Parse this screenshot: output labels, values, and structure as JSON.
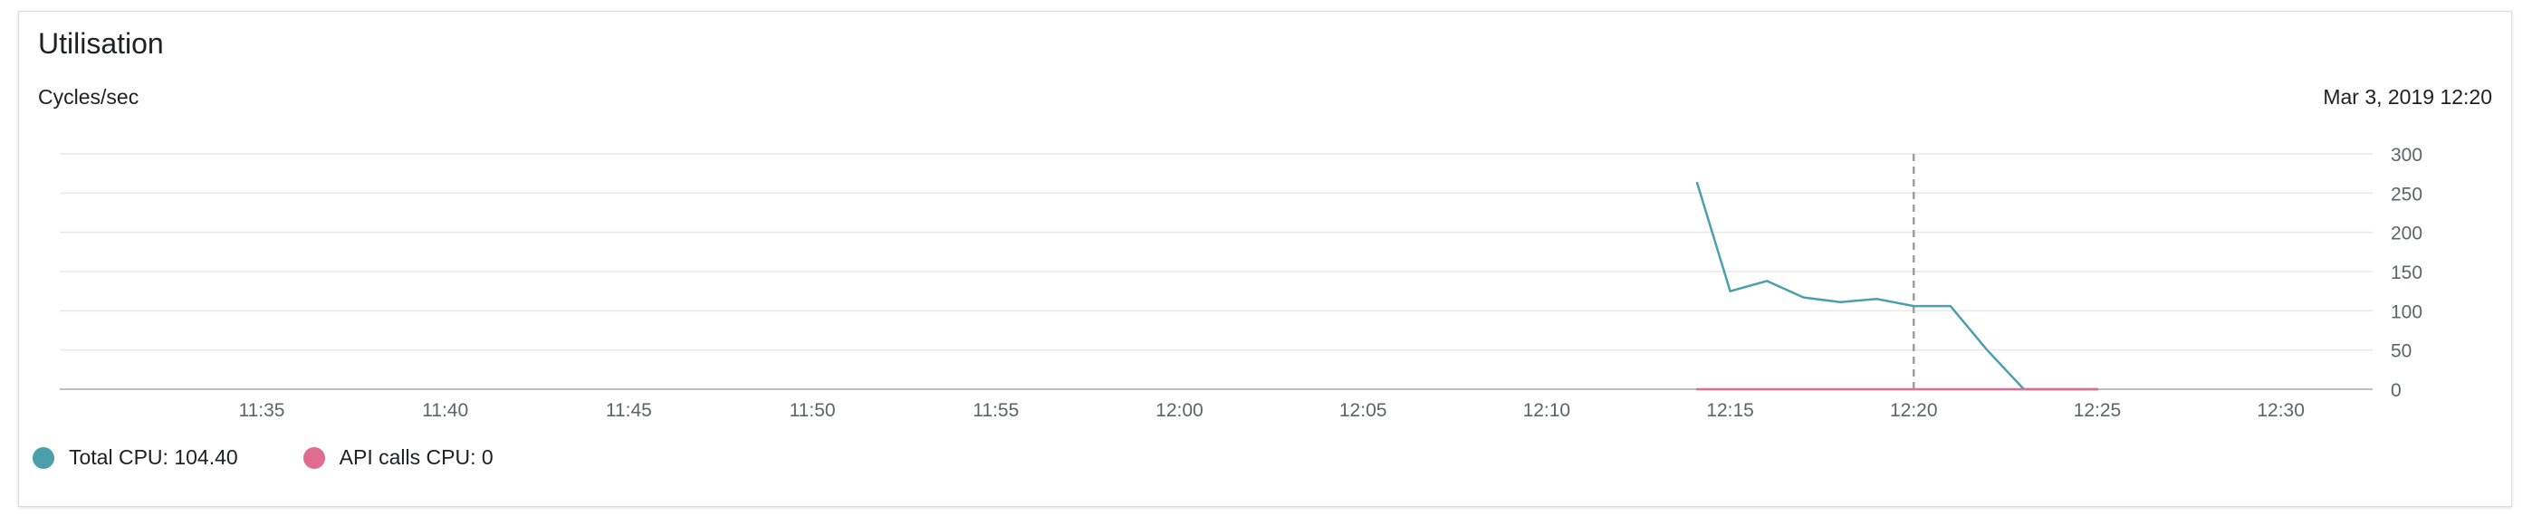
{
  "card": {
    "title": "Utilisation",
    "units": "Cycles/sec",
    "timestamp": "Mar 3, 2019 12:20"
  },
  "legend": {
    "items": [
      {
        "label": "Total CPU: 104.40",
        "color": "#4a9fab",
        "icon": "circle-dot"
      },
      {
        "label": "API calls CPU: 0",
        "color": "#e06c91",
        "icon": "circle-dot"
      }
    ]
  },
  "chart_data": {
    "type": "line",
    "x_axis_unit": "minutes",
    "x_ticks": [
      "11:35",
      "11:40",
      "11:45",
      "11:50",
      "11:55",
      "12:00",
      "12:05",
      "12:10",
      "12:15",
      "12:20",
      "12:25",
      "12:30"
    ],
    "x_tick_values": [
      695,
      700,
      705,
      710,
      715,
      720,
      725,
      730,
      735,
      740,
      745,
      750
    ],
    "xlim": [
      689.5,
      752.5
    ],
    "y_ticks": [
      0,
      50,
      100,
      150,
      200,
      250,
      300
    ],
    "ylim": [
      0,
      300
    ],
    "y_axis_position": "right",
    "grid": true,
    "cursor_x": 740,
    "series": [
      {
        "name": "Total CPU",
        "color": "#4a9fab",
        "x": [
          734.1,
          735.0,
          736.0,
          737.0,
          738.0,
          739.0,
          740.0,
          741.0,
          742.0,
          743.0,
          744.0,
          745.0
        ],
        "y": [
          263,
          125,
          138,
          117,
          111,
          115,
          106,
          106,
          50,
          0,
          0,
          0
        ]
      },
      {
        "name": "API calls CPU",
        "color": "#e06c91",
        "x": [
          734.1,
          745.0
        ],
        "y": [
          0,
          0
        ]
      }
    ]
  }
}
